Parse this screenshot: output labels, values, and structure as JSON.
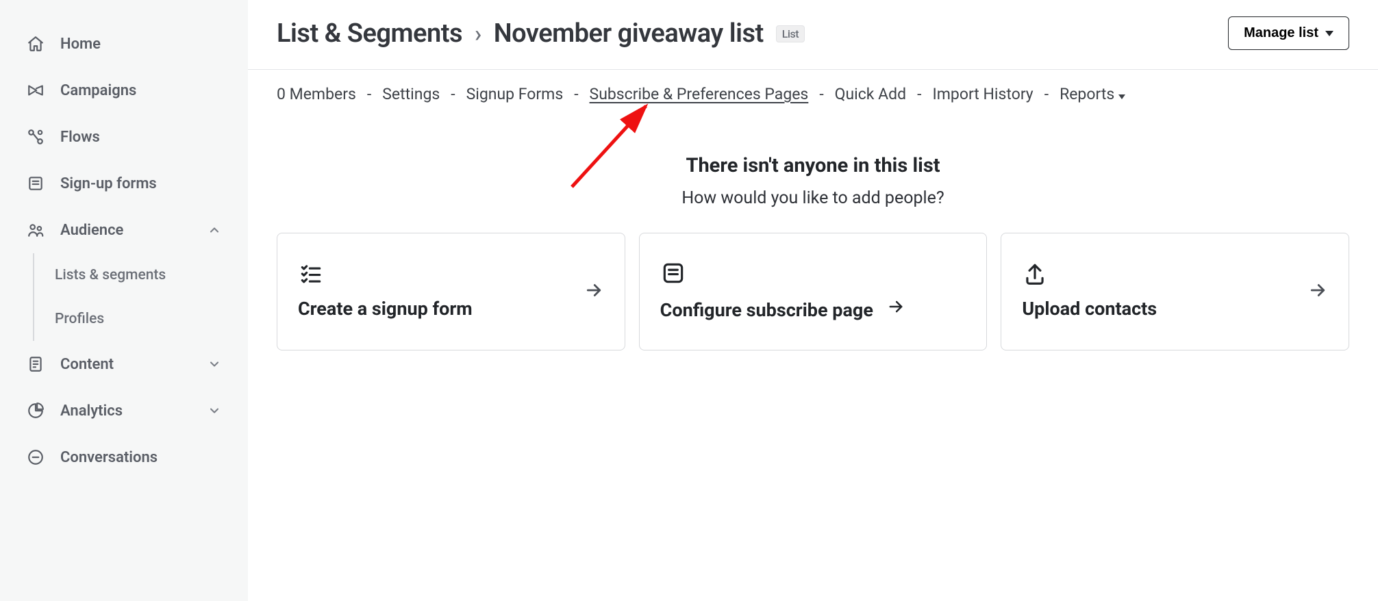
{
  "sidebar": {
    "items": [
      {
        "label": "Home"
      },
      {
        "label": "Campaigns"
      },
      {
        "label": "Flows"
      },
      {
        "label": "Sign-up forms"
      },
      {
        "label": "Audience",
        "expanded": true,
        "children": [
          {
            "label": "Lists & segments"
          },
          {
            "label": "Profiles"
          }
        ]
      },
      {
        "label": "Content",
        "expandable": true
      },
      {
        "label": "Analytics",
        "expandable": true
      },
      {
        "label": "Conversations"
      }
    ]
  },
  "header": {
    "breadcrumb_parent": "List & Segments",
    "breadcrumb_sep": "›",
    "breadcrumb_current": "November giveaway list",
    "badge": "List",
    "manage_label": "Manage list"
  },
  "tabs": {
    "members_count": 0,
    "members_label": "Members",
    "settings": "Settings",
    "signup_forms": "Signup Forms",
    "subscribe_pages": "Subscribe & Preferences Pages",
    "quick_add": "Quick Add",
    "import_history": "Import History",
    "reports": "Reports"
  },
  "empty": {
    "title": "There isn't anyone in this list",
    "subtitle": "How would you like to add people?"
  },
  "cards": [
    {
      "title": "Create a signup form"
    },
    {
      "title": "Configure subscribe page"
    },
    {
      "title": "Upload contacts"
    }
  ]
}
